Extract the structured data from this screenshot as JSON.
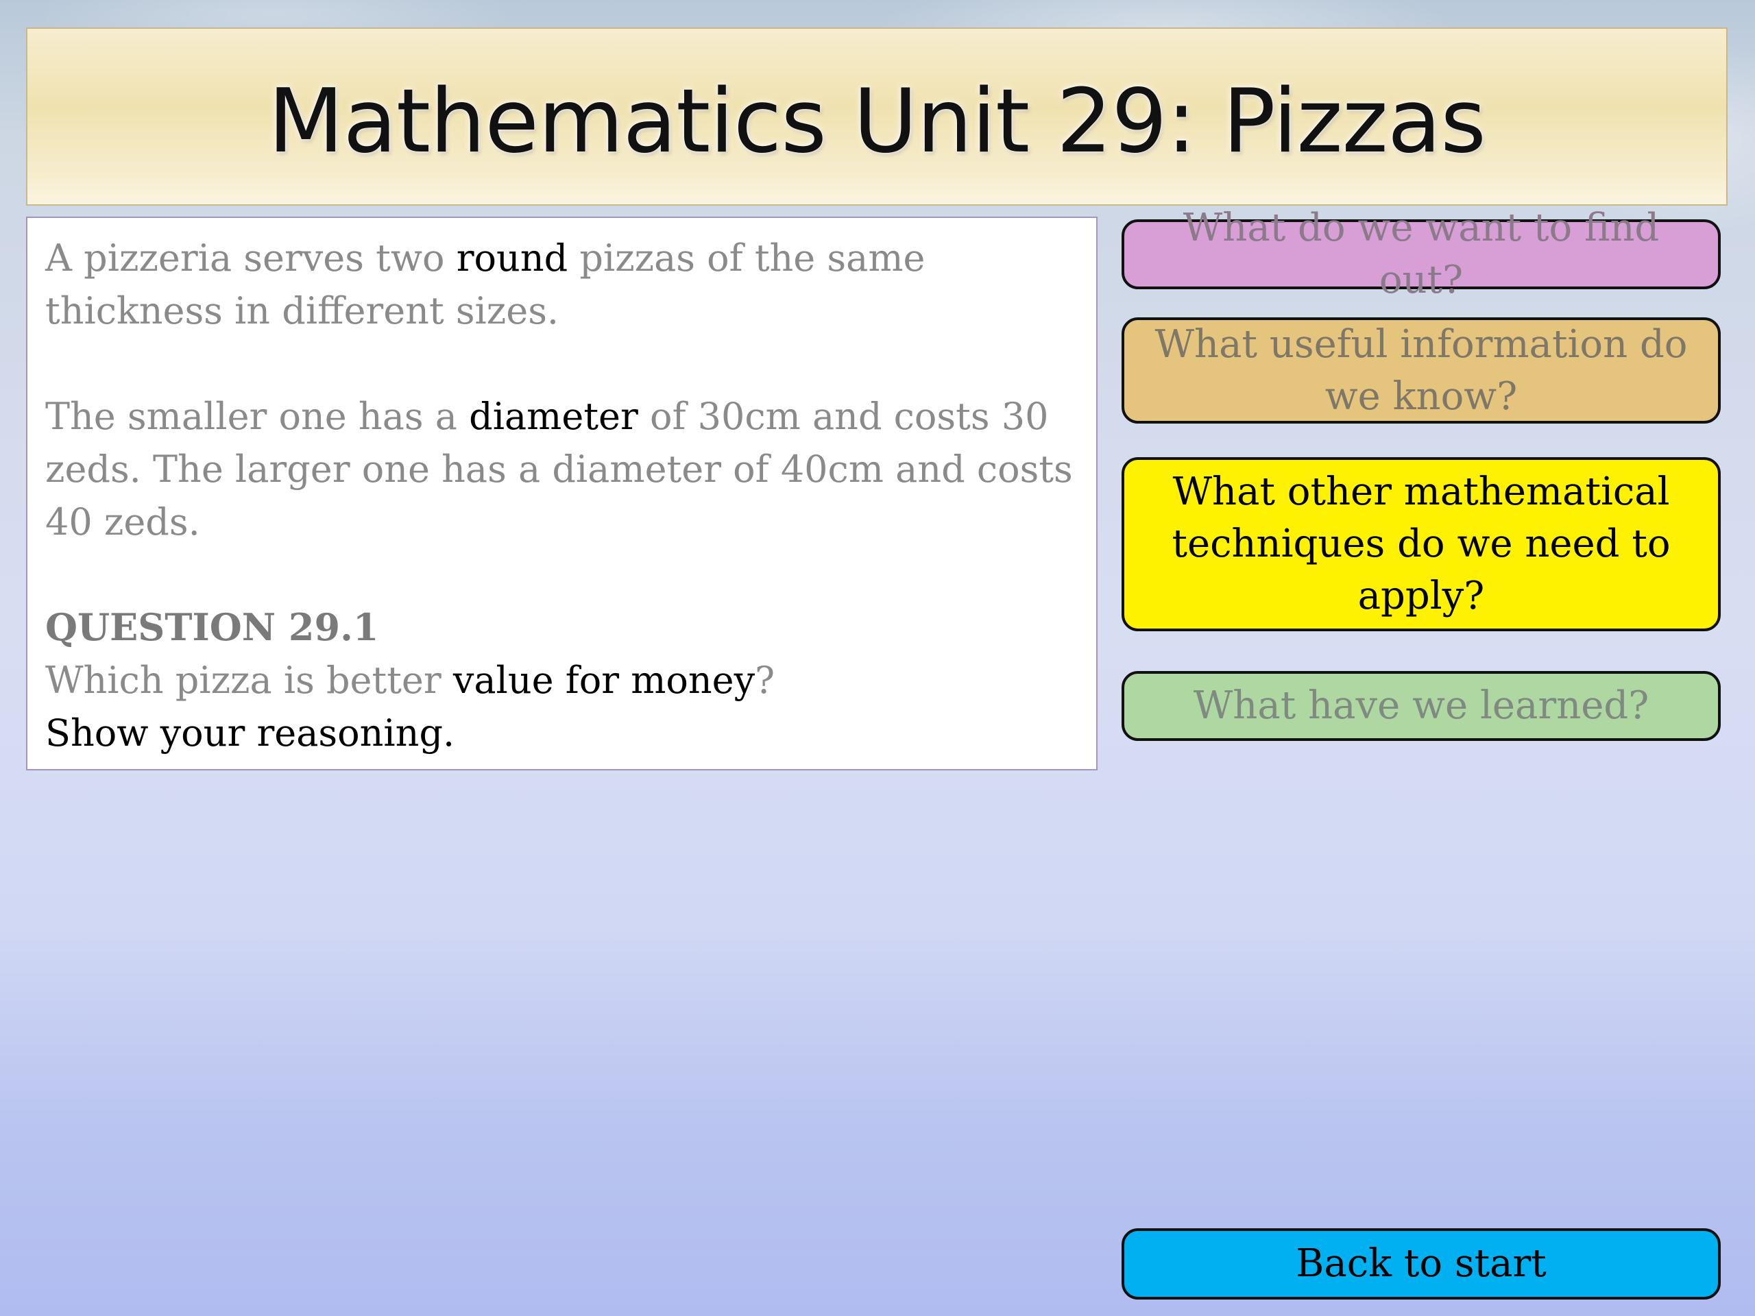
{
  "slide": {
    "title": "Mathematics Unit 29: Pizzas"
  },
  "question": {
    "para1": {
      "part1": "A pizzeria serves two ",
      "keyword": "round",
      "part2": " pizzas of the same thickness in different sizes."
    },
    "para2": {
      "part1": "The smaller one has a ",
      "keyword": "diameter",
      "part2": " of 30cm and costs 30 zeds.  The larger one has a diameter of 40cm and costs 40 zeds."
    },
    "heading": "QUESTION 29.1",
    "prompt": {
      "part1": "Which pizza is better ",
      "keyword": "value for money",
      "part2": "?"
    },
    "instruction": "Show your reasoning."
  },
  "buttons": {
    "find_out": "What do we want to find out?",
    "useful_info": "What useful information do we know?",
    "techniques": "What other mathematical techniques do we need to apply?",
    "learned": "What have we learned?",
    "back": "Back to start"
  },
  "colors": {
    "find_out": "#d79fd6",
    "useful_info": "#e5c57e",
    "techniques": "#fff200",
    "learned": "#aed7a2",
    "back": "#00b0f0",
    "title_band": "#f0e2b0"
  }
}
